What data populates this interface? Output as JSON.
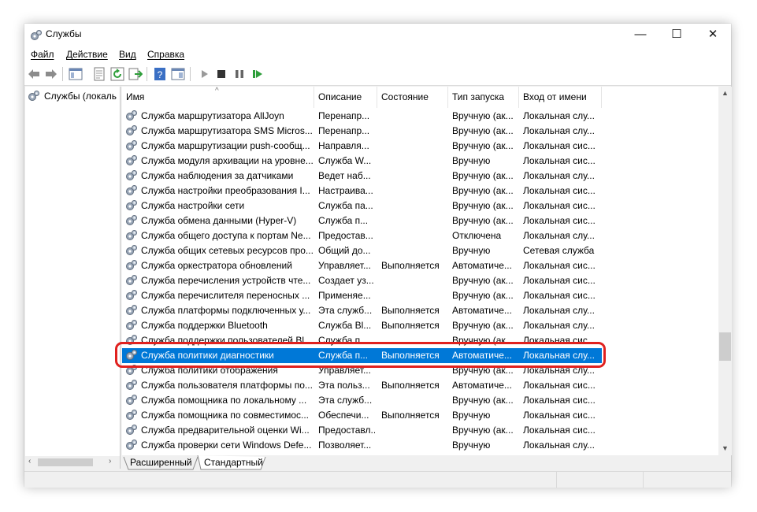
{
  "window": {
    "title": "Службы",
    "minimize": "—",
    "maximize": "☐",
    "close": "✕"
  },
  "menu": [
    {
      "label": "Файл"
    },
    {
      "label": "Действие"
    },
    {
      "label": "Вид"
    },
    {
      "label": "Справка"
    }
  ],
  "tree": {
    "root_label": "Службы (локаль"
  },
  "columns": [
    "Имя",
    "Описание",
    "Состояние",
    "Тип запуска",
    "Вход от имени"
  ],
  "rows": [
    {
      "name": "Служба маршрутизатора AllJoyn",
      "desc": "Перенапр...",
      "status": "",
      "startup": "Вручную (ак...",
      "logon": "Локальная слу..."
    },
    {
      "name": "Служба маршрутизатора SMS Micros...",
      "desc": "Перенапр...",
      "status": "",
      "startup": "Вручную (ак...",
      "logon": "Локальная слу..."
    },
    {
      "name": "Служба маршрутизации push-сообщ...",
      "desc": "Направля...",
      "status": "",
      "startup": "Вручную (ак...",
      "logon": "Локальная сис..."
    },
    {
      "name": "Служба модуля архивации на уровне...",
      "desc": "Служба W...",
      "status": "",
      "startup": "Вручную",
      "logon": "Локальная сис..."
    },
    {
      "name": "Служба наблюдения за датчиками",
      "desc": "Ведет наб...",
      "status": "",
      "startup": "Вручную (ак...",
      "logon": "Локальная слу..."
    },
    {
      "name": "Служба настройки преобразования I...",
      "desc": "Настраива...",
      "status": "",
      "startup": "Вручную (ак...",
      "logon": "Локальная сис..."
    },
    {
      "name": "Служба настройки сети",
      "desc": "Служба па...",
      "status": "",
      "startup": "Вручную (ак...",
      "logon": "Локальная сис..."
    },
    {
      "name": "Служба обмена данными (Hyper-V)",
      "desc": "Служба п...",
      "status": "",
      "startup": "Вручную (ак...",
      "logon": "Локальная сис..."
    },
    {
      "name": "Служба общего доступа к портам Ne...",
      "desc": "Предостав...",
      "status": "",
      "startup": "Отключена",
      "logon": "Локальная слу..."
    },
    {
      "name": "Служба общих сетевых ресурсов про...",
      "desc": "Общий до...",
      "status": "",
      "startup": "Вручную",
      "logon": "Сетевая служба"
    },
    {
      "name": "Служба оркестратора обновлений",
      "desc": "Управляет...",
      "status": "Выполняется",
      "startup": "Автоматиче...",
      "logon": "Локальная сис..."
    },
    {
      "name": "Служба перечисления устройств чте...",
      "desc": "Создает уз...",
      "status": "",
      "startup": "Вручную (ак...",
      "logon": "Локальная сис..."
    },
    {
      "name": "Служба перечислителя переносных ...",
      "desc": "Применяе...",
      "status": "",
      "startup": "Вручную (ак...",
      "logon": "Локальная сис..."
    },
    {
      "name": "Служба платформы подключенных у...",
      "desc": "Эта служб...",
      "status": "Выполняется",
      "startup": "Автоматиче...",
      "logon": "Локальная слу..."
    },
    {
      "name": "Служба поддержки Bluetooth",
      "desc": "Служба Bl...",
      "status": "Выполняется",
      "startup": "Вручную (ак...",
      "logon": "Локальная слу..."
    },
    {
      "name": "Служба поддержки пользователей Bl...",
      "desc": "Служба п...",
      "status": "",
      "startup": "Вручную (ак...",
      "logon": "Локальная сис..."
    },
    {
      "name": "Служба политики диагностики",
      "desc": "Служба п...",
      "status": "Выполняется",
      "startup": "Автоматиче...",
      "logon": "Локальная слу...",
      "selected": true
    },
    {
      "name": "Служба политики отображения",
      "desc": "Управляет...",
      "status": "",
      "startup": "Вручную (ак...",
      "logon": "Локальная слу..."
    },
    {
      "name": "Служба пользователя платформы по...",
      "desc": "Эта польз...",
      "status": "Выполняется",
      "startup": "Автоматиче...",
      "logon": "Локальная сис..."
    },
    {
      "name": "Служба помощника по локальному ...",
      "desc": "Эта служб...",
      "status": "",
      "startup": "Вручную (ак...",
      "logon": "Локальная сис..."
    },
    {
      "name": "Служба помощника по совместимос...",
      "desc": "Обеспечи...",
      "status": "Выполняется",
      "startup": "Вручную",
      "logon": "Локальная сис..."
    },
    {
      "name": "Служба предварительной оценки Wi...",
      "desc": "Предоставл...",
      "status": "",
      "startup": "Вручную (ак...",
      "logon": "Локальная сис..."
    },
    {
      "name": "Служба проверки сети Windows Defe...",
      "desc": "Позволяет...",
      "status": "",
      "startup": "Вручную",
      "logon": "Локальная слу..."
    }
  ],
  "tabs": [
    {
      "label": "Расширенный"
    },
    {
      "label": "Стандартный"
    }
  ],
  "colors": {
    "selection": "#0078d7",
    "highlight_ring": "#e0211f"
  }
}
